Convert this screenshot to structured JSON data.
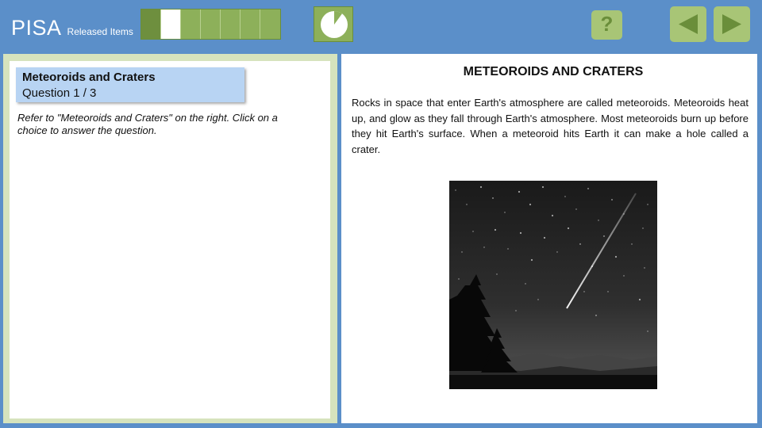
{
  "header": {
    "brand_main": "PISA",
    "brand_sub": "Released Items",
    "progress": {
      "total": 7,
      "completed": 1,
      "current": 2
    },
    "timer_fraction": 0.1,
    "help_label": "?"
  },
  "colors": {
    "header_bg": "#5b8fc9",
    "green": "#8db05a",
    "green_dark": "#6a8e3a",
    "question_box": "#b8d4f3"
  },
  "question": {
    "title": "Meteoroids and Craters",
    "number": "Question 1 / 3",
    "instruction": "Refer to \"Meteoroids and Craters\" on the right. Click on a choice to answer the question."
  },
  "stimulus": {
    "title": "METEOROIDS AND CRATERS",
    "text": "Rocks in space that enter Earth's atmosphere are called meteoroids. Meteoroids heat up, and glow as they fall through Earth's atmosphere. Most meteoroids burn up before they hit Earth's surface. When a meteoroid hits Earth it can make a hole called a crater.",
    "image": "night-sky-meteor-over-pine-trees"
  }
}
